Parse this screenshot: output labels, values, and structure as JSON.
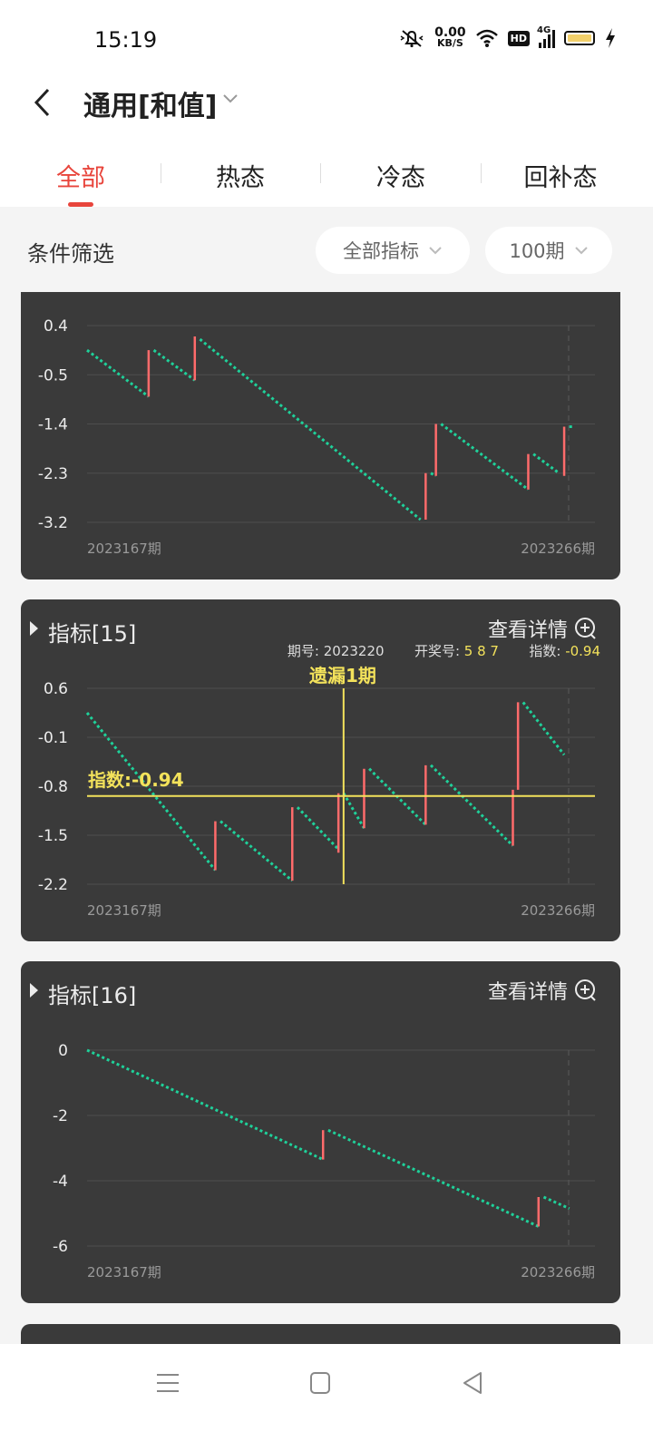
{
  "status_bar": {
    "time": "15:19",
    "net_speed_value": "0.00",
    "net_speed_unit": "KB/S",
    "hd": "HD",
    "network": "4G",
    "icons": [
      "mute-icon",
      "wifi-icon",
      "signal-icon",
      "battery-icon",
      "charging-icon"
    ]
  },
  "header": {
    "title": "通用[和值]",
    "tabs": [
      {
        "label": "全部",
        "active": true
      },
      {
        "label": "热态",
        "active": false
      },
      {
        "label": "冷态",
        "active": false
      },
      {
        "label": "回补态",
        "active": false
      }
    ]
  },
  "filter": {
    "label": "条件筛选",
    "indicator_select": "全部指标",
    "period_select": "100期"
  },
  "colors": {
    "accent": "#e8453c",
    "rise": "#ff6b6b",
    "fall": "#1fd19a",
    "highlight": "#f3e25b",
    "card_bg": "#3a3a3a"
  },
  "cards": [
    {
      "title": "",
      "detail_label": "",
      "x_start_label": "2023167期",
      "x_end_label": "2023266期"
    },
    {
      "title": "指标[15]",
      "detail_label": "查看详情",
      "x_start_label": "2023167期",
      "x_end_label": "2023266期",
      "info": {
        "period_label": "期号:",
        "period_value": "2023220",
        "draw_label": "开奖号:",
        "draw_value": "5 8 7",
        "index_label": "指数:",
        "index_value": "-0.94"
      },
      "miss_label": "遗漏1期",
      "index_line_label": "指数:-0.94"
    },
    {
      "title": "指标[16]",
      "detail_label": "查看详情",
      "x_start_label": "2023167期",
      "x_end_label": "2023266期"
    }
  ],
  "chart_data": [
    {
      "type": "line",
      "x_range": [
        "2023167期",
        "2023266期"
      ],
      "y_ticks": [
        "0.4",
        "-0.5",
        "-1.4",
        "-2.3",
        "-3.2"
      ],
      "ylim": [
        -3.2,
        0.4
      ],
      "segments": [
        {
          "from": [
            0,
            -0.05
          ],
          "to": [
            12,
            -0.9
          ]
        },
        {
          "from": [
            13,
            -0.05
          ],
          "to": [
            21,
            -0.6
          ]
        },
        {
          "from": [
            22,
            0.15
          ],
          "to": [
            65,
            -3.15
          ]
        },
        {
          "from": [
            67,
            -2.3
          ],
          "to": [
            68,
            -2.35
          ]
        },
        {
          "from": [
            69,
            -1.4
          ],
          "to": [
            86,
            -2.6
          ]
        },
        {
          "from": [
            87,
            -1.95
          ],
          "to": [
            92,
            -2.3
          ]
        },
        {
          "from": [
            94,
            -1.45
          ],
          "to": [
            95,
            -1.45
          ]
        }
      ],
      "jumps": [
        {
          "x": 12,
          "from": -0.9,
          "to": -0.05
        },
        {
          "x": 21,
          "from": -0.6,
          "to": 0.2
        },
        {
          "x": 66,
          "from": -3.15,
          "to": -2.3
        },
        {
          "x": 68,
          "from": -2.35,
          "to": -1.4
        },
        {
          "x": 86,
          "from": -2.6,
          "to": -1.95
        },
        {
          "x": 93,
          "from": -2.35,
          "to": -1.45
        }
      ]
    },
    {
      "type": "line",
      "x_range": [
        "2023167期",
        "2023266期"
      ],
      "y_ticks": [
        "0.6",
        "-0.1",
        "-0.8",
        "-1.5",
        "-2.2"
      ],
      "ylim": [
        -2.2,
        0.6
      ],
      "segments": [
        {
          "from": [
            0,
            0.25
          ],
          "to": [
            25,
            -2.0
          ]
        },
        {
          "from": [
            26,
            -1.3
          ],
          "to": [
            40,
            -2.15
          ]
        },
        {
          "from": [
            41,
            -1.1
          ],
          "to": [
            49,
            -1.7
          ]
        },
        {
          "from": [
            50,
            -0.9
          ],
          "to": [
            54,
            -1.4
          ]
        },
        {
          "from": [
            55,
            -0.55
          ],
          "to": [
            66,
            -1.35
          ]
        },
        {
          "from": [
            67,
            -0.5
          ],
          "to": [
            83,
            -1.65
          ]
        },
        {
          "from": [
            85,
            0.4
          ],
          "to": [
            93,
            -0.35
          ]
        }
      ],
      "jumps": [
        {
          "x": 25,
          "from": -2.0,
          "to": -1.3
        },
        {
          "x": 40,
          "from": -2.15,
          "to": -1.1
        },
        {
          "x": 49,
          "from": -1.75,
          "to": -0.9
        },
        {
          "x": 54,
          "from": -1.4,
          "to": -0.55
        },
        {
          "x": 66,
          "from": -1.35,
          "to": -0.5
        },
        {
          "x": 83,
          "from": -1.65,
          "to": -0.85
        },
        {
          "x": 84,
          "from": -0.85,
          "to": 0.4
        }
      ],
      "cursor": {
        "x": 50,
        "index": -0.94
      }
    },
    {
      "type": "line",
      "x_range": [
        "2023167期",
        "2023266期"
      ],
      "y_ticks": [
        "0",
        "-2",
        "-4",
        "-6"
      ],
      "ylim": [
        -6,
        0
      ],
      "segments": [
        {
          "from": [
            0,
            0
          ],
          "to": [
            46,
            -3.35
          ]
        },
        {
          "from": [
            47,
            -2.45
          ],
          "to": [
            88,
            -5.4
          ]
        },
        {
          "from": [
            89,
            -4.5
          ],
          "to": [
            94,
            -4.85
          ]
        }
      ],
      "jumps": [
        {
          "x": 46,
          "from": -3.35,
          "to": -2.45
        },
        {
          "x": 88,
          "from": -5.4,
          "to": -4.5
        }
      ]
    }
  ]
}
